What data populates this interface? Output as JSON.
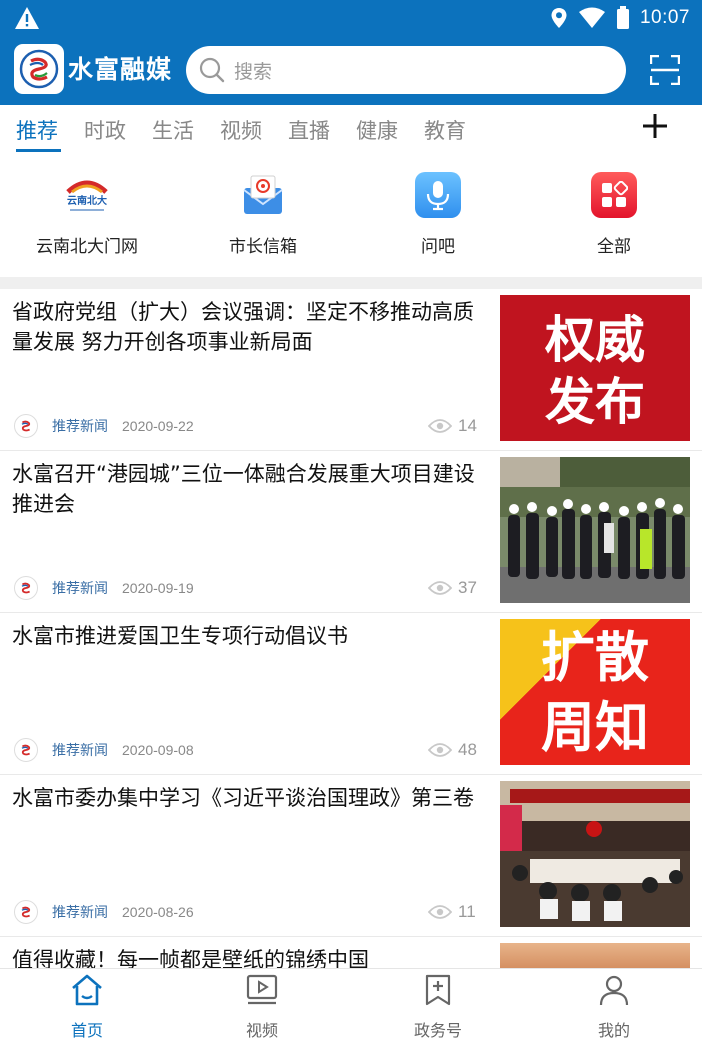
{
  "status_bar": {
    "time": "10:07"
  },
  "header": {
    "app_name": "水富融媒",
    "search_placeholder": "搜索"
  },
  "tabs": [
    {
      "label": "推荐",
      "active": true
    },
    {
      "label": "时政"
    },
    {
      "label": "生活"
    },
    {
      "label": "视频"
    },
    {
      "label": "直播"
    },
    {
      "label": "健康"
    },
    {
      "label": "教育"
    }
  ],
  "quick_entries": [
    {
      "label": "云南北大门网",
      "icon": "yunnan-north-gate-logo-icon",
      "logo_text": "云南北大"
    },
    {
      "label": "市长信箱",
      "icon": "mailbox-icon"
    },
    {
      "label": "问吧",
      "icon": "microphone-icon"
    },
    {
      "label": "全部",
      "icon": "all-apps-icon"
    }
  ],
  "news": [
    {
      "title": "省政府党组（扩大）会议强调：坚定不移推动高质量发展 努力开创各项事业新局面",
      "source": "推荐新闻",
      "date": "2020-09-22",
      "views": "14",
      "thumb": {
        "type": "text",
        "text": [
          "权威",
          "发布"
        ],
        "bg": "#c0141f",
        "fg": "#ffffff"
      }
    },
    {
      "title": "水富召开“港园城”三位一体融合发展重大项目建设推进会",
      "source": "推荐新闻",
      "date": "2020-09-19",
      "views": "37",
      "thumb": {
        "type": "photo-people"
      }
    },
    {
      "title": "水富市推进爱国卫生专项行动倡议书",
      "source": "推荐新闻",
      "date": "2020-09-08",
      "views": "48",
      "thumb": {
        "type": "text",
        "text": [
          "扩散",
          "周知"
        ],
        "bg": "#e8241b",
        "fg": "#ffffff",
        "accent": "#f6c21a"
      }
    },
    {
      "title": "水富市委办集中学习《习近平谈治国理政》第三卷",
      "source": "推荐新闻",
      "date": "2020-08-26",
      "views": "11",
      "thumb": {
        "type": "photo-meeting"
      }
    },
    {
      "title": "值得收藏！每一帧都是壁纸的锦绣中国",
      "thumb": {
        "type": "photo-sunset"
      }
    }
  ],
  "bottom_nav": [
    {
      "label": "首页",
      "icon": "home-icon",
      "active": true
    },
    {
      "label": "视频",
      "icon": "video-icon"
    },
    {
      "label": "政务号",
      "icon": "gov-account-icon"
    },
    {
      "label": "我的",
      "icon": "profile-icon"
    }
  ],
  "colors": {
    "brand": "#0c72bd",
    "accent_red": "#c0141f"
  }
}
